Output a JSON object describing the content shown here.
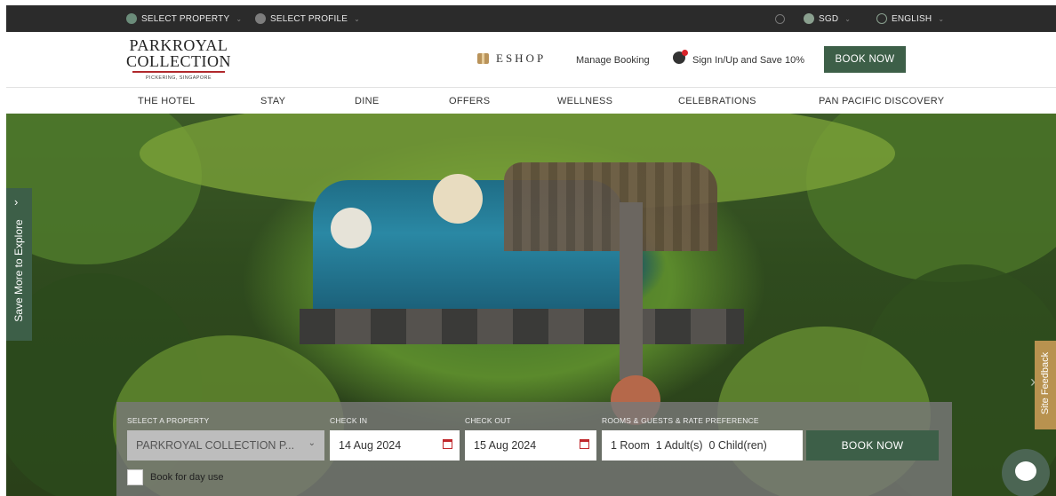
{
  "topbar": {
    "select_property": "SELECT PROPERTY",
    "select_profile": "SELECT PROFILE",
    "currency": "SGD",
    "language": "ENGLISH"
  },
  "header": {
    "logo_line1": "PARKROYAL",
    "logo_line2": "COLLECTION",
    "logo_sub": "PICKERING, SINGAPORE",
    "eshop": "ESHOP",
    "manage_booking": "Manage Booking",
    "sign_in": "Sign In/Up and Save 10%",
    "book_now": "BOOK NOW"
  },
  "nav": {
    "items": [
      "THE HOTEL",
      "STAY",
      "DINE",
      "OFFERS",
      "WELLNESS",
      "CELEBRATIONS",
      "PAN PACIFIC DISCOVERY"
    ]
  },
  "hero": {
    "side_tab": "Save More to Explore",
    "feedback": "Site Feedback"
  },
  "booking": {
    "property_label": "SELECT A PROPERTY",
    "property_value": "PARKROYAL COLLECTION P...",
    "checkin_label": "CHECK IN",
    "checkin_value": "14 Aug 2024",
    "checkout_label": "CHECK OUT",
    "checkout_value": "15 Aug 2024",
    "rooms_label": "ROOMS & GUESTS & RATE PREFERENCE",
    "rooms_value": "1 Room  1 Adult(s)  0 Child(ren)",
    "book_now": "BOOK NOW",
    "day_use": "Book for day use"
  },
  "colors": {
    "brand_green": "#3d5f48",
    "accent_red": "#c0282c",
    "feedback_gold": "#b8924f"
  }
}
